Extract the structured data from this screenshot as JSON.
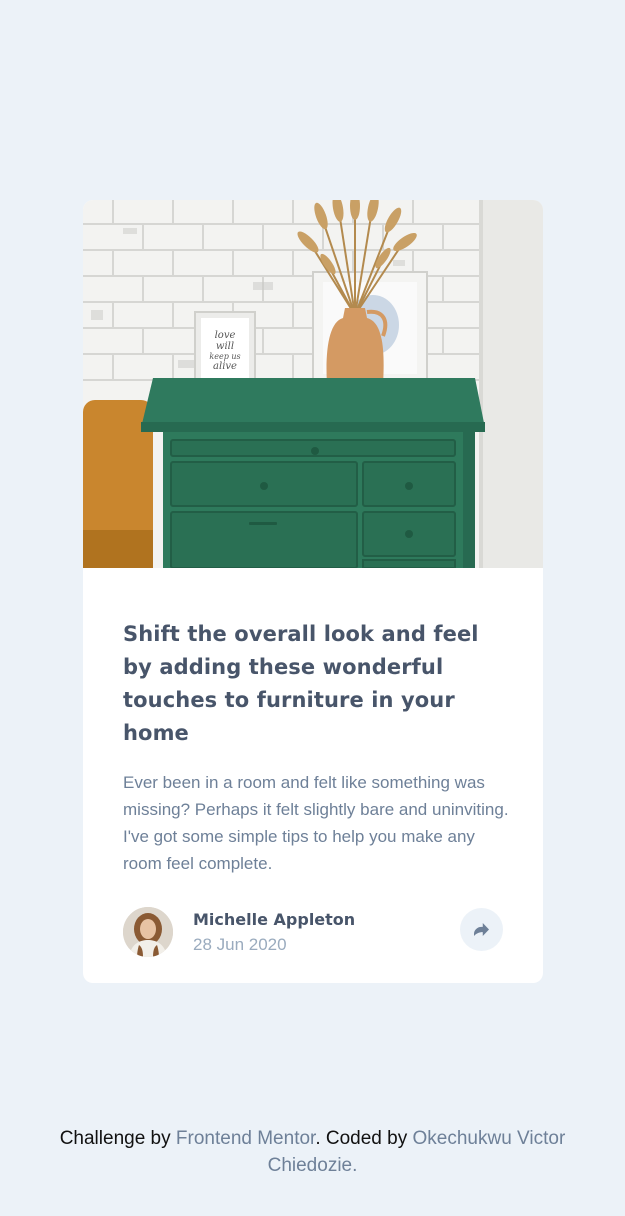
{
  "article": {
    "title": "Shift the overall look and feel by adding these wonderful touches to furniture in your home",
    "description": "Ever been in a room and felt like something was missing? Perhaps it felt slightly bare and uninviting. I've got some simple tips to help you make any room feel complete.",
    "image_alt": "drawers",
    "frame_text": [
      "love",
      "will",
      "keep us",
      "alive"
    ]
  },
  "author": {
    "name": "Michelle Appleton",
    "date": "28 Jun 2020",
    "avatar_icon": "avatar-photo"
  },
  "share": {
    "icon": "share-icon"
  },
  "attribution": {
    "prefix": "Challenge by",
    "link1": "Frontend Mentor",
    "middle": ". Coded by",
    "link2": "Okechukwu Victor Chiedozie",
    "suffix": "."
  },
  "colors": {
    "page_bg": "#ecf2f8",
    "card_bg": "#ffffff",
    "title": "#48556a",
    "text": "#6e8098",
    "date": "#9aabbe",
    "share_bg": "#ecf2f8"
  }
}
